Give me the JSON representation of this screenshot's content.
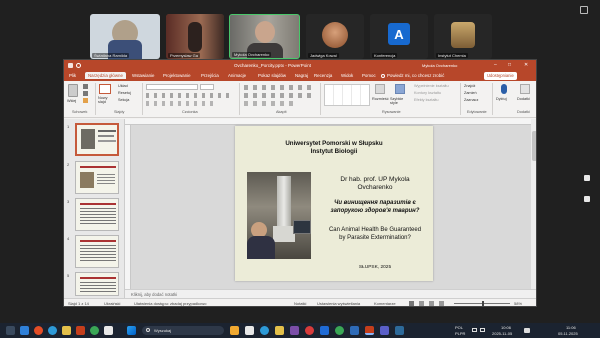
{
  "meeting": {
    "participants": [
      {
        "name": "Światłana Ramilda"
      },
      {
        "name": "Przemysław Ga"
      },
      {
        "name": "Mykola Ovcharenko"
      },
      {
        "name": "Jadwiga Kowal"
      },
      {
        "name": "Konferencja"
      },
      {
        "name": "Instytut Chemia"
      }
    ]
  },
  "powerpoint": {
    "window_title": "Ovcharenko_Porcity.pptx - PowerPoint",
    "user_name": "Mykola Ovcharenko",
    "tabs": [
      "Plik",
      "Narzędzia główne",
      "Wstawianie",
      "Projektowanie",
      "Przejścia",
      "Animacje",
      "Pokaz slajdów",
      "Nagraj",
      "Recenzja",
      "Widok",
      "Pomoc",
      "Powiedz mi, co chcesz zrobić"
    ],
    "share_label": "Udostępnianie",
    "ribbon": {
      "paste": "Wklej",
      "new_slide": "Nowy slajd",
      "layout": "Układ",
      "reset": "Resetuj",
      "section": "Sekcja",
      "arrange": "Rozmieść",
      "quick_styles": "Szybkie style",
      "shape_fill": "Wypełnienie kształtu",
      "shape_outline": "Kontury kształtu",
      "shape_effects": "Efekty kształtu",
      "find": "Znajdź",
      "replace": "Zamień",
      "select": "Zaznacz",
      "dictate": "Dyktuj",
      "addins": "Dodatki",
      "groups": [
        "Schowek",
        "Slajdy",
        "Czcionka",
        "Akapit",
        "Rysowanie",
        "Edytowanie",
        "Dodatki"
      ]
    },
    "slide": {
      "university": "Uniwersytet Pomorski w Słupsku",
      "institute": "Instytut Biologii",
      "author_line1": "Dr hab. prof. UP Mykola",
      "author_line2": "Ovcharenko",
      "title_ua_1": "Чи винищення паразитів є",
      "title_ua_2": "запорукою здоров'я тварин?",
      "title_en_1": "Can Animal Health Be Guaranteed",
      "title_en_2": "by Parasite Extermination?",
      "place_year": "SŁUPSK, 2025"
    },
    "thumbnails": [
      "1",
      "2",
      "3",
      "4",
      "5"
    ],
    "notes_placeholder": "Kliknij, aby dodać notatki",
    "status": {
      "slide_of": "Slajd 1 z 14",
      "lang": "Ukraiński",
      "accessibility": "Ułatwienia dostępu: zbadaj przypadkowo",
      "notes": "Notatki",
      "display": "Ustawienia wyświetlania",
      "comments": "Komentarze",
      "zoom": "58%"
    }
  },
  "taskbar": {
    "search_placeholder": "Wyszukaj",
    "lang": "POL",
    "lang2": "PLPR",
    "time": "10:06",
    "date": "2025-11-05"
  },
  "corner": {
    "time": "11:06",
    "date": "05.11.2025"
  },
  "colors": {
    "ppt_accent": "#b7472a",
    "taskbar": "#1b2330"
  }
}
